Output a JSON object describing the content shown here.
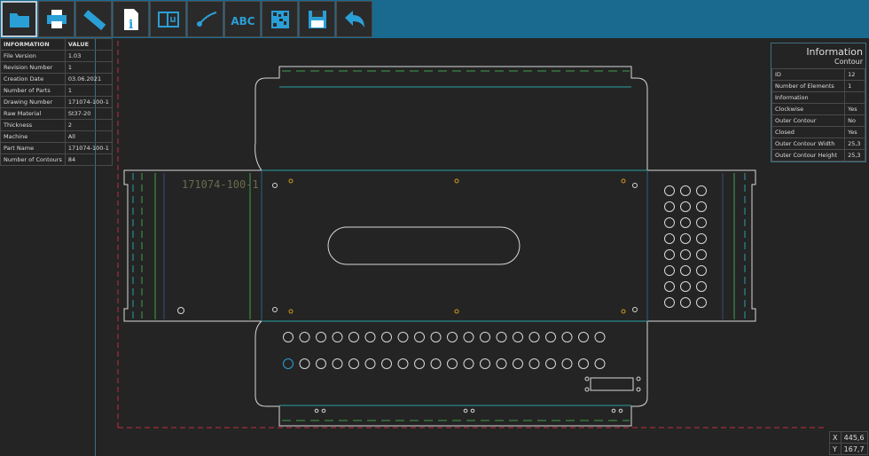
{
  "toolbar": {
    "buttons": [
      {
        "name": "open-folder",
        "icon": "folder-icon"
      },
      {
        "name": "print",
        "icon": "printer-icon"
      },
      {
        "name": "measure",
        "icon": "ruler-icon"
      },
      {
        "name": "info",
        "icon": "info-document-icon"
      },
      {
        "name": "view-toggle",
        "icon": "window-power-icon"
      },
      {
        "name": "laser",
        "icon": "laser-icon"
      },
      {
        "name": "text",
        "icon": "abc-text-icon",
        "label": "ABC"
      },
      {
        "name": "qr-code",
        "icon": "qr-code-icon"
      },
      {
        "name": "save",
        "icon": "floppy-disk-icon"
      },
      {
        "name": "back",
        "icon": "undo-arrow-icon"
      }
    ]
  },
  "info_table": {
    "headers": [
      "INFORMATION",
      "VALUE"
    ],
    "rows": [
      [
        "File Version",
        "1.03"
      ],
      [
        "Revision Number",
        "1"
      ],
      [
        "Creation Date",
        "03.06.2021"
      ],
      [
        "Number of Parts",
        "1"
      ],
      [
        "Drawing Number",
        "171074-100-1"
      ],
      [
        "Raw Material",
        "St37-20"
      ],
      [
        "Thickness",
        "2"
      ],
      [
        "Machine",
        "All"
      ],
      [
        "Part Name",
        "171074-100-1"
      ],
      [
        "Number of Contours",
        "84"
      ]
    ]
  },
  "contour_panel": {
    "title": "Information",
    "subtitle": "Contour",
    "rows": [
      [
        "ID",
        "12"
      ],
      [
        "Number of Elements",
        "1"
      ],
      [
        "Information",
        ""
      ],
      [
        "Clockwise",
        "Yes"
      ],
      [
        "Outer Contour",
        "No"
      ],
      [
        "Closed",
        "Yes"
      ],
      [
        "Outer Contour Width",
        "25,3"
      ],
      [
        "Outer Contour Height",
        "25,3"
      ]
    ]
  },
  "drawing": {
    "part_label": "171074-100-1"
  },
  "coords": {
    "x_label": "X",
    "x": "445,6",
    "y_label": "Y",
    "y": "167,7"
  },
  "colors": {
    "toolbar": "#1a6a90",
    "icon": "#2a9fd6",
    "outline": "#d8d8d8",
    "bend_teal": "#2aa0a0",
    "bend_green": "#3fa04a",
    "boundary_red": "#c0303a",
    "marker_orange": "#d49a1a"
  }
}
